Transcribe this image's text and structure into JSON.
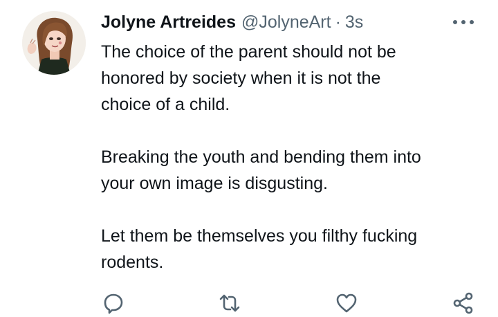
{
  "tweet": {
    "display_name": "Jolyne Artreides",
    "handle": "@JolyneArt",
    "separator": "·",
    "timestamp": "3s",
    "body": {
      "line1": "The choice of the parent should not be",
      "line2": "honored by society when it is not the",
      "line3": "choice of a child.",
      "line4": "Breaking the youth and bending them into",
      "line5": "your own image is disgusting.",
      "line6": "Let them be themselves you filthy fucking",
      "line7": "rodents."
    }
  },
  "icons": {
    "avatar": "avatar-illustration",
    "more": "more-options-icon",
    "reply": "reply-icon",
    "retweet": "retweet-icon",
    "like": "like-icon",
    "share": "share-icon"
  },
  "colors": {
    "text": "#0f1419",
    "secondary": "#536471",
    "icon": "#536471",
    "background": "#ffffff"
  }
}
